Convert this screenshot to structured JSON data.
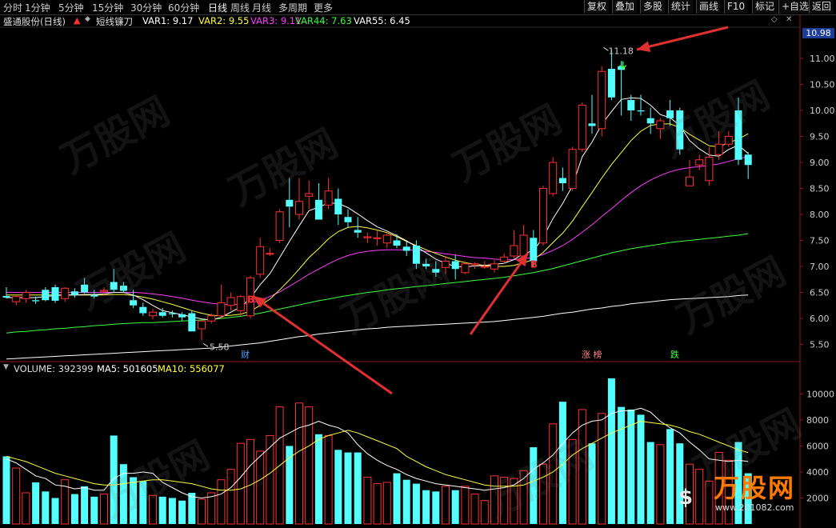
{
  "toolbar": {
    "timeframes": [
      "分时",
      "1分钟",
      "5分钟",
      "15分钟",
      "30分钟",
      "60分钟",
      "日线",
      "周线",
      "月线",
      "多周期",
      "更多"
    ],
    "active": "日线",
    "right_buttons": [
      "复权",
      "叠加",
      "多股",
      "统计",
      "画线",
      "F10",
      "标记",
      "+自选",
      "返回"
    ]
  },
  "info": {
    "stock": "盛通股份(日线)",
    "indicator": "短线镰刀",
    "var1": "VAR1: 9.17",
    "var2": "VAR2: 9.55",
    "var3": "VAR3: 9.11",
    "var44": "VAR44: 7.63",
    "var55": "VAR55: 6.45"
  },
  "volume_info": {
    "volume": "VOLUME: 392399",
    "ma5": "MA5: 501605",
    "ma10": "MA10: 556077"
  },
  "price_axis": [
    "11.00",
    "10.50",
    "10.00",
    "9.50",
    "9.00",
    "8.50",
    "8.00",
    "7.50",
    "7.00",
    "6.50",
    "6.00",
    "5.50"
  ],
  "volume_axis": [
    "10000",
    "8000",
    "6000",
    "4000",
    "2000"
  ],
  "current_price": "10.98",
  "annotations": {
    "high_label": "11.18",
    "low_label": "5.58",
    "buy_marker": "B",
    "event_cai": "财",
    "event_zhangbang": "涨 榜",
    "event_die": "跌"
  },
  "watermark": {
    "text": "万股网",
    "logo_main": "万股网",
    "logo_url": "www.201082.com",
    "logo_symbol": "$"
  },
  "colors": {
    "up": "#ff3030",
    "down": "#54ffff",
    "var1": "#ffffff",
    "var2": "#ffff3b",
    "var3": "#ff3bff",
    "var44": "#3bff3b",
    "var55": "#ffffff",
    "arrow": "#e03030",
    "price_box": "#1e3c9a"
  },
  "chart_data": {
    "type": "candlestick",
    "ylim": [
      5.2,
      11.6
    ],
    "volume_ylim": [
      0,
      11500
    ],
    "candles": [
      [
        6.43,
        6.6,
        6.38,
        6.4
      ],
      [
        6.32,
        6.45,
        6.25,
        6.42
      ],
      [
        6.38,
        6.55,
        6.3,
        6.5
      ],
      [
        6.35,
        6.42,
        6.28,
        6.33
      ],
      [
        6.55,
        6.6,
        6.33,
        6.35
      ],
      [
        6.6,
        6.65,
        6.3,
        6.34
      ],
      [
        6.38,
        6.6,
        6.32,
        6.58
      ],
      [
        6.52,
        6.58,
        6.4,
        6.45
      ],
      [
        6.65,
        6.78,
        6.48,
        6.5
      ],
      [
        6.45,
        6.55,
        6.38,
        6.42
      ],
      [
        6.52,
        6.6,
        6.45,
        6.54
      ],
      [
        6.7,
        6.95,
        6.5,
        6.55
      ],
      [
        6.63,
        6.7,
        6.5,
        6.53
      ],
      [
        6.35,
        6.55,
        6.2,
        6.25
      ],
      [
        6.22,
        6.3,
        6.05,
        6.1
      ],
      [
        6.05,
        6.18,
        5.98,
        6.12
      ],
      [
        6.12,
        6.2,
        6.02,
        6.05
      ],
      [
        6.1,
        6.15,
        6.02,
        6.08
      ],
      [
        6.08,
        6.12,
        5.95,
        6.02
      ],
      [
        6.1,
        6.15,
        5.85,
        5.75
      ],
      [
        5.8,
        5.95,
        5.58,
        5.95
      ],
      [
        5.95,
        6.1,
        5.9,
        6.05
      ],
      [
        6.05,
        6.65,
        6.0,
        6.3
      ],
      [
        6.25,
        6.5,
        6.15,
        6.4
      ],
      [
        6.15,
        6.45,
        6.05,
        6.42
      ],
      [
        6.05,
        6.82,
        6.0,
        6.78
      ],
      [
        6.85,
        7.55,
        6.78,
        7.38
      ],
      [
        7.25,
        7.35,
        7.2,
        7.25
      ],
      [
        7.5,
        8.1,
        7.45,
        8.05
      ],
      [
        8.28,
        8.7,
        7.75,
        8.15
      ],
      [
        8.0,
        8.7,
        7.9,
        8.25
      ],
      [
        8.35,
        8.65,
        8.1,
        8.4
      ],
      [
        8.28,
        8.6,
        7.9,
        7.9
      ],
      [
        8.18,
        8.7,
        8.1,
        8.45
      ],
      [
        8.3,
        8.5,
        7.8,
        8.0
      ],
      [
        7.95,
        8.1,
        7.75,
        7.85
      ],
      [
        7.7,
        7.95,
        7.55,
        7.65
      ],
      [
        7.55,
        7.65,
        7.45,
        7.57
      ],
      [
        7.55,
        7.7,
        7.4,
        7.55
      ],
      [
        7.45,
        7.65,
        7.35,
        7.6
      ],
      [
        7.5,
        7.62,
        7.35,
        7.4
      ],
      [
        7.38,
        7.48,
        7.2,
        7.3
      ],
      [
        7.4,
        7.5,
        6.95,
        7.05
      ],
      [
        7.05,
        7.15,
        6.95,
        7.0
      ],
      [
        6.95,
        7.1,
        6.8,
        6.88
      ],
      [
        6.98,
        7.2,
        6.85,
        7.1
      ],
      [
        7.1,
        7.22,
        6.75,
        6.95
      ],
      [
        6.88,
        7.1,
        6.85,
        7.05
      ],
      [
        7.03,
        7.08,
        6.95,
        7.05
      ],
      [
        7.0,
        7.1,
        6.95,
        7.0
      ],
      [
        6.95,
        7.12,
        6.88,
        7.05
      ],
      [
        7.1,
        7.25,
        7.05,
        7.18
      ],
      [
        7.2,
        7.7,
        7.15,
        7.4
      ],
      [
        7.2,
        7.8,
        7.15,
        7.6
      ],
      [
        7.55,
        7.7,
        7.0,
        7.1
      ],
      [
        7.45,
        8.55,
        7.4,
        8.5
      ],
      [
        8.4,
        9.1,
        8.35,
        9.0
      ],
      [
        8.7,
        8.9,
        8.45,
        8.6
      ],
      [
        8.5,
        9.3,
        8.45,
        9.25
      ],
      [
        9.25,
        10.15,
        9.2,
        10.1
      ],
      [
        9.75,
        10.3,
        9.55,
        9.7
      ],
      [
        9.65,
        10.85,
        9.5,
        10.75
      ],
      [
        10.8,
        11.18,
        10.2,
        10.25
      ],
      [
        10.85,
        10.95,
        9.9,
        10.78
      ],
      [
        10.2,
        10.3,
        9.8,
        10.0
      ],
      [
        10.0,
        10.3,
        9.9,
        9.98
      ],
      [
        9.85,
        10.05,
        9.55,
        9.75
      ],
      [
        9.65,
        9.85,
        9.45,
        9.8
      ],
      [
        10.0,
        10.2,
        9.7,
        9.85
      ],
      [
        10.0,
        10.05,
        9.15,
        9.25
      ],
      [
        8.55,
        9.05,
        8.55,
        8.72
      ],
      [
        8.95,
        9.15,
        8.85,
        9.05
      ],
      [
        8.65,
        9.3,
        8.55,
        9.1
      ],
      [
        9.15,
        9.6,
        9.05,
        9.35
      ],
      [
        9.35,
        9.6,
        9.3,
        9.5
      ],
      [
        10.0,
        10.25,
        8.95,
        9.05
      ],
      [
        9.15,
        9.2,
        8.68,
        8.95
      ]
    ],
    "volume": [
      5200,
      4300,
      2400,
      3200,
      2500,
      2000,
      3400,
      2300,
      2900,
      2100,
      2300,
      6800,
      4600,
      3600,
      3300,
      2200,
      2100,
      2000,
      1800,
      2400,
      1900,
      2400,
      3400,
      4200,
      6200,
      6500,
      5600,
      6800,
      9000,
      6000,
      9300,
      9000,
      6900,
      6800,
      5700,
      5500,
      5500,
      3600,
      3100,
      3200,
      3900,
      3400,
      3100,
      2600,
      2500,
      2900,
      2600,
      2900,
      2300,
      1800,
      3700,
      3600,
      3500,
      4100,
      5900,
      4600,
      7700,
      9400,
      6500,
      8800,
      6200,
      8500,
      11200,
      9000,
      8800,
      8400,
      6300,
      6100,
      7300,
      6200,
      4600,
      4200,
      3300,
      5500,
      4900,
      6300,
      3900
    ],
    "var1": [
      6.4,
      6.4,
      6.4,
      6.4,
      6.42,
      6.44,
      6.45,
      6.45,
      6.46,
      6.46,
      6.47,
      6.5,
      6.5,
      6.45,
      6.36,
      6.25,
      6.15,
      6.11,
      6.07,
      6.03,
      5.99,
      5.97,
      6.02,
      6.12,
      6.22,
      6.39,
      6.65,
      6.86,
      7.17,
      7.48,
      7.78,
      8.07,
      8.14,
      8.22,
      8.21,
      8.13,
      8.01,
      7.88,
      7.76,
      7.68,
      7.59,
      7.49,
      7.38,
      7.26,
      7.14,
      7.06,
      7.0,
      6.99,
      7.01,
      7.02,
      7.04,
      7.06,
      7.13,
      7.25,
      7.3,
      7.56,
      7.92,
      8.21,
      8.55,
      9.11,
      9.39,
      9.73,
      9.98,
      10.21,
      10.24,
      10.23,
      10.1,
      9.92,
      9.86,
      9.71,
      9.42,
      9.26,
      9.14,
      9.12,
      9.25,
      9.33,
      9.17
    ],
    "var2": [
      6.45,
      6.45,
      6.45,
      6.45,
      6.45,
      6.45,
      6.45,
      6.45,
      6.45,
      6.45,
      6.45,
      6.46,
      6.46,
      6.44,
      6.41,
      6.37,
      6.32,
      6.27,
      6.21,
      6.15,
      6.1,
      6.06,
      6.05,
      6.06,
      6.08,
      6.14,
      6.25,
      6.37,
      6.55,
      6.74,
      6.95,
      7.17,
      7.34,
      7.53,
      7.67,
      7.75,
      7.77,
      7.74,
      7.7,
      7.65,
      7.57,
      7.48,
      7.4,
      7.32,
      7.25,
      7.18,
      7.12,
      7.07,
      7.04,
      7.02,
      7.0,
      7.0,
      7.02,
      7.07,
      7.13,
      7.27,
      7.46,
      7.64,
      7.87,
      8.15,
      8.42,
      8.7,
      8.96,
      9.19,
      9.42,
      9.6,
      9.71,
      9.74,
      9.74,
      9.67,
      9.54,
      9.43,
      9.32,
      9.3,
      9.38,
      9.45,
      9.55
    ],
    "var3": [
      6.5,
      6.5,
      6.5,
      6.5,
      6.5,
      6.5,
      6.5,
      6.5,
      6.5,
      6.5,
      6.5,
      6.5,
      6.5,
      6.5,
      6.49,
      6.47,
      6.45,
      6.42,
      6.39,
      6.35,
      6.32,
      6.29,
      6.27,
      6.27,
      6.27,
      6.29,
      6.35,
      6.42,
      6.51,
      6.62,
      6.73,
      6.85,
      6.95,
      7.05,
      7.14,
      7.21,
      7.26,
      7.29,
      7.31,
      7.32,
      7.32,
      7.32,
      7.31,
      7.29,
      7.27,
      7.24,
      7.22,
      7.19,
      7.17,
      7.16,
      7.14,
      7.13,
      7.13,
      7.15,
      7.17,
      7.23,
      7.31,
      7.4,
      7.52,
      7.66,
      7.8,
      7.96,
      8.11,
      8.27,
      8.42,
      8.55,
      8.66,
      8.75,
      8.82,
      8.87,
      8.9,
      8.92,
      8.94,
      8.97,
      9.02,
      9.07,
      9.11
    ],
    "var44": [
      5.72,
      5.74,
      5.75,
      5.77,
      5.78,
      5.8,
      5.81,
      5.83,
      5.84,
      5.86,
      5.87,
      5.89,
      5.9,
      5.91,
      5.92,
      5.92,
      5.93,
      5.94,
      5.95,
      5.96,
      5.97,
      5.98,
      6.0,
      6.02,
      6.04,
      6.07,
      6.1,
      6.14,
      6.18,
      6.22,
      6.26,
      6.3,
      6.34,
      6.37,
      6.41,
      6.44,
      6.47,
      6.5,
      6.52,
      6.55,
      6.57,
      6.59,
      6.61,
      6.63,
      6.65,
      6.67,
      6.69,
      6.71,
      6.73,
      6.75,
      6.77,
      6.79,
      6.82,
      6.85,
      6.88,
      6.92,
      6.96,
      7.01,
      7.06,
      7.11,
      7.16,
      7.21,
      7.26,
      7.3,
      7.34,
      7.37,
      7.4,
      7.43,
      7.46,
      7.48,
      7.5,
      7.52,
      7.54,
      7.56,
      7.58,
      7.6,
      7.63
    ],
    "var55": [
      5.22,
      5.23,
      5.24,
      5.25,
      5.26,
      5.27,
      5.28,
      5.29,
      5.3,
      5.31,
      5.32,
      5.33,
      5.34,
      5.35,
      5.36,
      5.37,
      5.38,
      5.39,
      5.4,
      5.41,
      5.42,
      5.43,
      5.45,
      5.47,
      5.49,
      5.51,
      5.53,
      5.56,
      5.59,
      5.62,
      5.65,
      5.67,
      5.7,
      5.72,
      5.74,
      5.76,
      5.78,
      5.8,
      5.81,
      5.83,
      5.84,
      5.85,
      5.86,
      5.87,
      5.88,
      5.89,
      5.9,
      5.91,
      5.92,
      5.93,
      5.94,
      5.96,
      5.98,
      6.0,
      6.02,
      6.04,
      6.07,
      6.1,
      6.12,
      6.15,
      6.18,
      6.2,
      6.23,
      6.25,
      6.28,
      6.3,
      6.32,
      6.34,
      6.36,
      6.37,
      6.38,
      6.39,
      6.4,
      6.41,
      6.42,
      6.44,
      6.45
    ],
    "vol_ma5": [
      5000,
      4700,
      4200,
      3700,
      3500,
      3000,
      2900,
      2700,
      2800,
      2600,
      2600,
      3500,
      3900,
      3900,
      4000,
      3900,
      3200,
      2800,
      2400,
      2100,
      2000,
      2100,
      2300,
      2800,
      3600,
      4500,
      5200,
      5900,
      6600,
      7000,
      7400,
      7600,
      7900,
      7600,
      7400,
      7000,
      6100,
      5400,
      4900,
      4500,
      4200,
      3800,
      3500,
      3300,
      3100,
      3000,
      2900,
      2800,
      2700,
      2600,
      2700,
      2800,
      3000,
      3500,
      4200,
      4700,
      5300,
      6200,
      7000,
      7600,
      7900,
      8000,
      8500,
      8700,
      8700,
      8900,
      8600,
      7900,
      7400,
      7000,
      6300,
      5700,
      5000,
      4900,
      4800,
      4900,
      4800
    ],
    "vol_ma10": [
      5200,
      5000,
      4800,
      4500,
      4200,
      3900,
      3700,
      3500,
      3300,
      3100,
      3000,
      3000,
      3100,
      3200,
      3300,
      3400,
      3400,
      3300,
      3200,
      3100,
      2900,
      2700,
      2600,
      2600,
      2700,
      3000,
      3400,
      3900,
      4500,
      5100,
      5600,
      6000,
      6500,
      6800,
      7000,
      7200,
      7000,
      6700,
      6400,
      6100,
      5800,
      5200,
      4800,
      4400,
      4100,
      3800,
      3600,
      3400,
      3200,
      3000,
      2900,
      2900,
      2900,
      3000,
      3300,
      3600,
      4000,
      4600,
      5300,
      5800,
      6200,
      6600,
      7000,
      7300,
      7600,
      7900,
      7800,
      7700,
      7600,
      7400,
      7100,
      6900,
      6600,
      6300,
      6000,
      5700,
      5500
    ]
  }
}
